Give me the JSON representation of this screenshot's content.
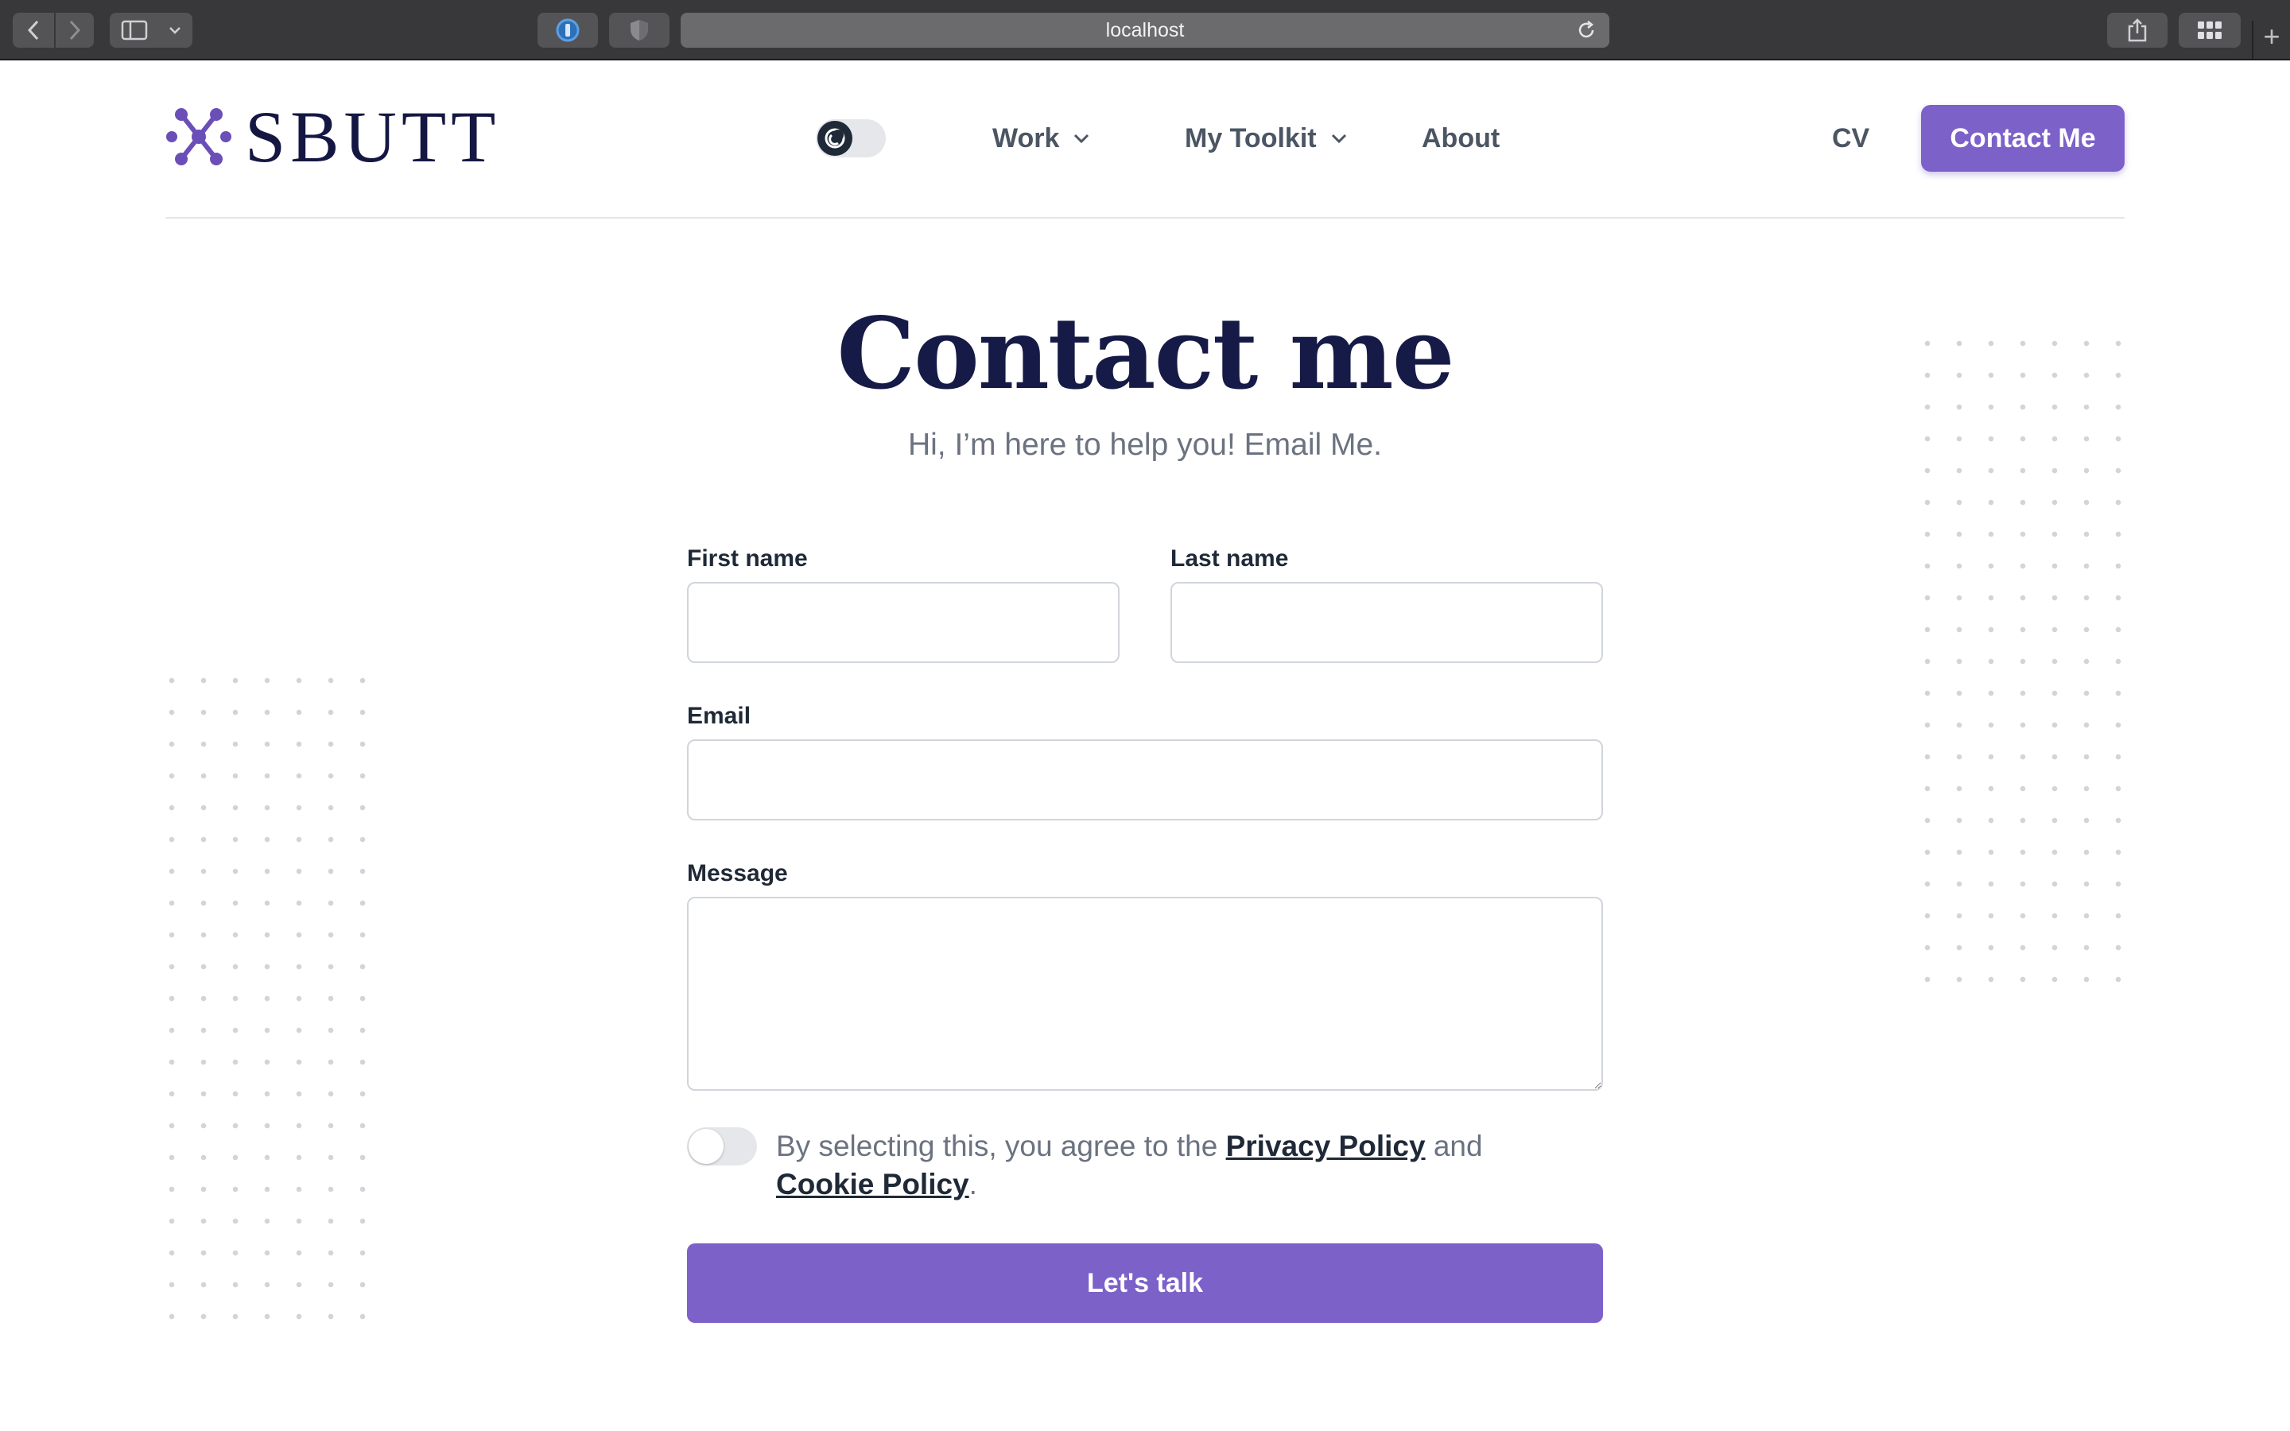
{
  "browser": {
    "url": "localhost"
  },
  "header": {
    "logo_text": "SBUTT",
    "nav": {
      "work": "Work",
      "toolkit": "My Toolkit",
      "about": "About",
      "cv": "CV"
    },
    "contact_button": "Contact Me",
    "accent_color": "#7c61c9"
  },
  "main": {
    "title": "Contact me",
    "subtitle": "Hi, I’m here to help you! Email Me.",
    "form": {
      "first_name_label": "First name",
      "first_name_value": "",
      "last_name_label": "Last name",
      "last_name_value": "",
      "email_label": "Email",
      "email_value": "",
      "message_label": "Message",
      "message_value": "",
      "consent_prefix": "By selecting this, you agree to the",
      "privacy_link": "Privacy Policy",
      "consent_and": "and",
      "cookie_link": "Cookie Policy",
      "consent_suffix": ".",
      "submit_label": "Let's talk"
    }
  }
}
